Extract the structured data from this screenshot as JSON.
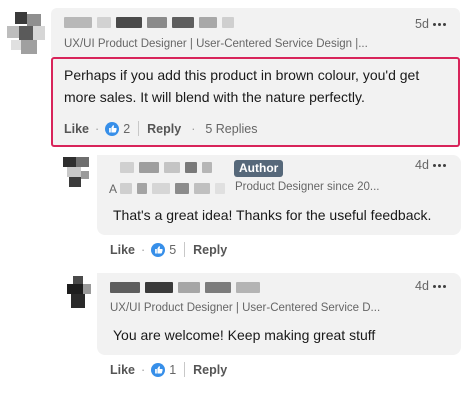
{
  "comments": [
    {
      "headline": "UX/UI Product Designer | User-Centered Service Design |...",
      "time": "5d",
      "text": "Perhaps if you add this product in brown colour, you'd get more sales. It will blend with the nature perfectly.",
      "like_label": "Like",
      "like_count": "2",
      "reply_label": "Reply",
      "replies_label": "5 Replies"
    },
    {
      "badge": "Author",
      "name_initial": "A",
      "headline": "Product Designer since 20...",
      "time": "4d",
      "text": "That's a great idea! Thanks for the useful feedback.",
      "like_label": "Like",
      "like_count": "5",
      "reply_label": "Reply"
    },
    {
      "headline": "UX/UI Product Designer | User-Centered Service D...",
      "time": "4d",
      "text": "You are welcome! Keep making great stuff",
      "like_label": "Like",
      "like_count": "1",
      "reply_label": "Reply"
    }
  ],
  "colors": {
    "highlight_border": "#d8245a",
    "like_badge": "#378fe9",
    "bubble": "#f2f2f2",
    "author_badge": "#56687a"
  },
  "icons": [
    "more-horizontal-icon",
    "thumbs-up-icon"
  ]
}
